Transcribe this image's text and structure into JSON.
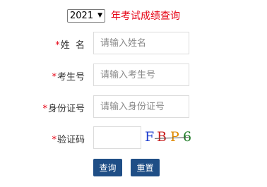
{
  "header": {
    "year_value": "2021",
    "year_dropdown_icon": "triangle-down",
    "title": "年考试成绩查询"
  },
  "form": {
    "name": {
      "required_mark": "*",
      "label": "姓  名",
      "placeholder": "请输入姓名",
      "value": ""
    },
    "exam_no": {
      "required_mark": "*",
      "label": "考生号",
      "placeholder": "请输入考生号",
      "value": ""
    },
    "id_no": {
      "required_mark": "*",
      "label": "身份证号",
      "placeholder": "请输入身份证号",
      "value": ""
    },
    "captcha": {
      "required_mark": "*",
      "label": "验证码",
      "placeholder": "",
      "value": "",
      "image_text": [
        "F",
        "B",
        "P",
        "6"
      ]
    }
  },
  "buttons": {
    "query": "查询",
    "reset": "重置"
  },
  "colors": {
    "required": "#e60012",
    "title": "#e60012",
    "button_bg": "#1f4e86",
    "button_text": "#ffffff"
  }
}
